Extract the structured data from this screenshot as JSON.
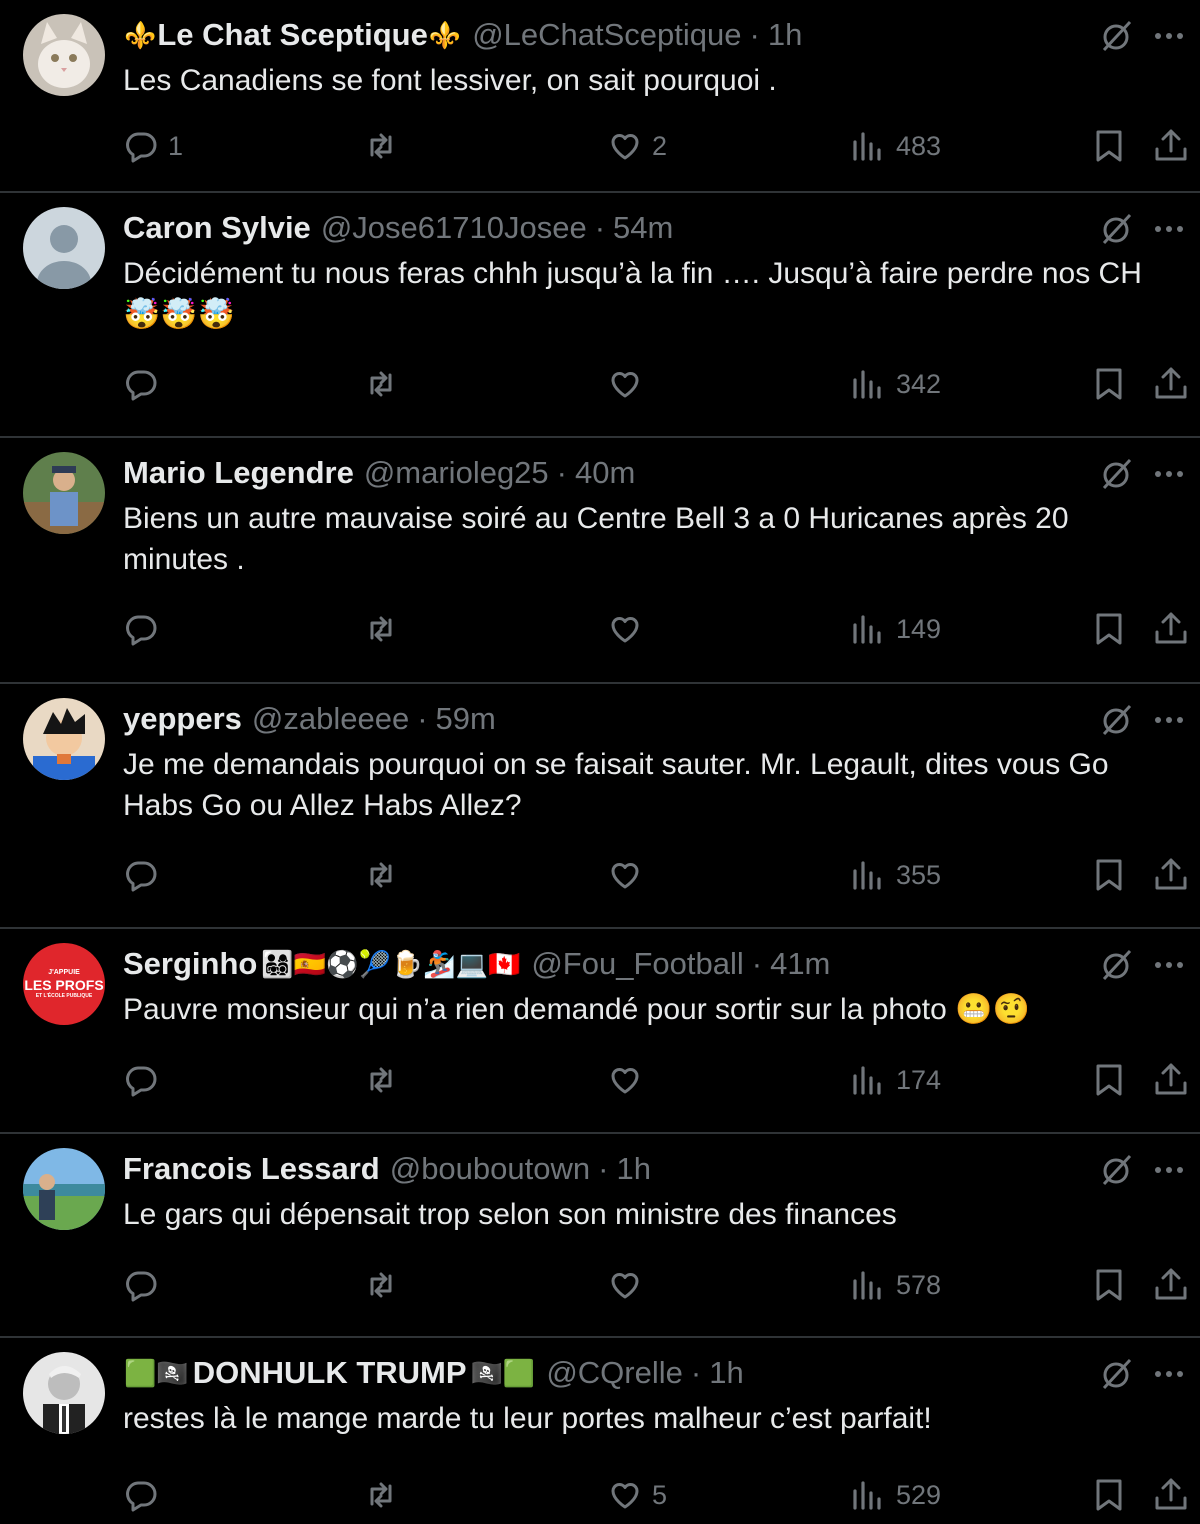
{
  "tweets": [
    {
      "name": "Le Chat Sceptique",
      "name_prefix": "⚜️",
      "name_suffix": "⚜️",
      "handle": "@LeChatSceptique",
      "separator": "·",
      "time": "1h",
      "text": "Les Canadiens se font lessiver, on sait pourquoi .",
      "replies": "1",
      "reposts": "",
      "likes": "2",
      "views": "483"
    },
    {
      "name": "Caron Sylvie",
      "handle": "@Jose61710Josee",
      "separator": "·",
      "time": "54m",
      "text": "Décidément tu nous feras chhh jusqu’à la fin …. Jusqu’à faire perdre nos CH 🤯🤯🤯",
      "replies": "",
      "reposts": "",
      "likes": "",
      "views": "342"
    },
    {
      "name": "Mario Legendre",
      "handle": "@marioleg25",
      "separator": "·",
      "time": "40m",
      "text": "Biens un autre mauvaise soiré au Centre Bell 3 a 0 Huricanes après 20 minutes .",
      "replies": "",
      "reposts": "",
      "likes": "",
      "views": "149"
    },
    {
      "name": "yeppers",
      "handle": "@zableeee",
      "separator": "·",
      "time": "59m",
      "text": "Je me demandais pourquoi on se faisait sauter. Mr. Legault, dites vous Go Habs Go ou Allez Habs Allez?",
      "replies": "",
      "reposts": "",
      "likes": "",
      "views": "355"
    },
    {
      "name": "Serginho",
      "name_suffix": "👨‍👩‍👧‍👦🇪🇸⚽🎾🍺🏂💻🇨🇦",
      "handle": "@Fou_Football",
      "separator": "·",
      "time": "41m",
      "text": "Pauvre monsieur qui n’a rien demandé pour sortir sur la photo 😬🤨",
      "avatar_line1": "J'APPUIE",
      "avatar_line2": "LES PROFS",
      "avatar_line3": "ET L'ÉCOLE PUBLIQUE",
      "replies": "",
      "reposts": "",
      "likes": "",
      "views": "174"
    },
    {
      "name": "Francois Lessard",
      "handle": "@bouboutown",
      "separator": "·",
      "time": "1h",
      "text": "Le gars qui dépensait trop selon son ministre des finances",
      "replies": "",
      "reposts": "",
      "likes": "",
      "views": "578"
    },
    {
      "name": "DONHULK TRUMP",
      "name_prefix": "🟩🏴‍☠️",
      "name_suffix": "🏴‍☠️🟩",
      "handle": "@CQrelle",
      "separator": "·",
      "time": "1h",
      "text": "restes là le mange marde tu leur portes malheur c’est parfait!",
      "replies": "",
      "reposts": "",
      "likes": "5",
      "views": "529"
    }
  ],
  "colors": {
    "background": "#000000",
    "text_primary": "#e7e9ea",
    "text_secondary": "#71767b",
    "divider": "#2f3336"
  }
}
